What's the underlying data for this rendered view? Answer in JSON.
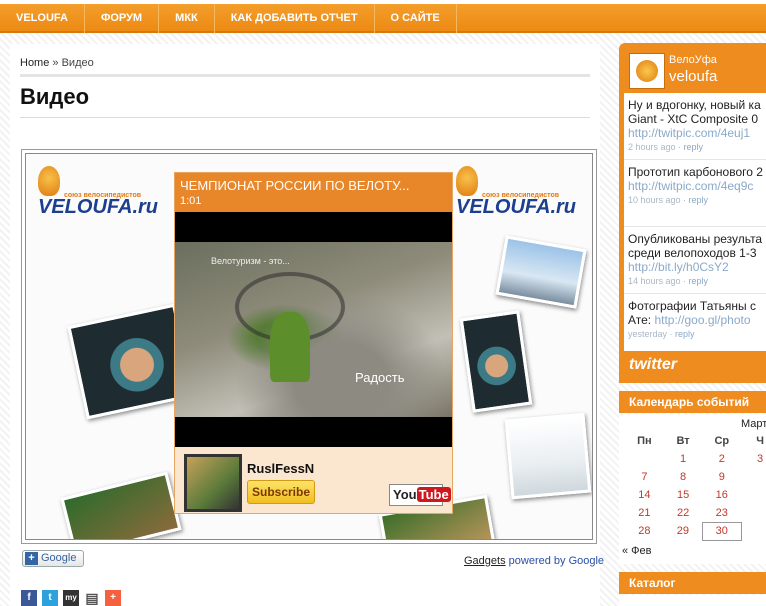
{
  "nav": {
    "items": [
      "VELOUFA",
      "ФОРУМ",
      "МКК",
      "КАК ДОБАВИТЬ ОТЧЕТ",
      "О САЙТЕ"
    ]
  },
  "breadcrumb": {
    "home": "Home",
    "separator": "»",
    "current": "Видео"
  },
  "page_title": "Видео",
  "gadget": {
    "logo_text": "VELOUFA.ru",
    "logo_sub": "союз велосипедистов",
    "player": {
      "title": "ЧЕМПИОНАТ РОССИИ ПО ВЕЛОТУ...",
      "duration": "1:01",
      "caption_1": "Велотуризм - это...",
      "caption_2": "Радость",
      "channel": "RuslFessN",
      "subscribe_label": "Subscribe",
      "youtube_you": "You",
      "youtube_tube": "Tube"
    }
  },
  "gplus_label": "Google",
  "gadgets_credit": {
    "gadgets": "Gadgets",
    "powered": "powered by Google"
  },
  "share_icons": [
    {
      "name": "facebook-icon",
      "glyph": "f",
      "color": "#3b5998"
    },
    {
      "name": "twitter-icon",
      "glyph": "t",
      "color": "#2ea1dc"
    },
    {
      "name": "myspace-icon",
      "glyph": "my",
      "color": "#333333"
    },
    {
      "name": "print-icon",
      "glyph": "▤",
      "color": "#555555"
    },
    {
      "name": "addthis-icon",
      "glyph": "+",
      "color": "#f5603e"
    }
  ],
  "twitter_widget": {
    "name": "ВелоУфа",
    "user": "veloufa",
    "footer": "twitter",
    "tweets": [
      {
        "text_1": "Ну и вдогонку, новый ка",
        "text_2": "Giant - XtC Composite 0",
        "link": "http://twitpic.com/4euj1",
        "time": "2 hours ago",
        "reply": "reply"
      },
      {
        "text_1": "Прототип карбонового 2",
        "text_2": "",
        "link": "http://twitpic.com/4eq9c",
        "time": "10 hours ago",
        "reply": "reply"
      },
      {
        "text_1": "Опубликованы результа",
        "text_2": "среди велопоходов 1-3",
        "link": "http://bit.ly/h0CsY2",
        "time": "14 hours ago",
        "reply": "reply"
      },
      {
        "text_1": "Фотографии Татьяны с",
        "text_2": "Ате:",
        "link": "http://goo.gl/photo",
        "time": "yesterday",
        "reply": "reply"
      }
    ]
  },
  "calendar": {
    "heading": "Календарь событий",
    "month": "Март",
    "weekdays": [
      "Пн",
      "Вт",
      "Ср",
      "Ч"
    ],
    "rows": [
      [
        "1",
        "2",
        "3"
      ],
      [
        "7",
        "8",
        "9"
      ],
      [
        "14",
        "15",
        "16"
      ],
      [
        "21",
        "22",
        "23"
      ],
      [
        "28",
        "29",
        "30"
      ]
    ],
    "prev": "« Фев"
  },
  "catalog_heading": "Каталог",
  "colors": {
    "accent": "#ee8c1f",
    "link": "#2a5fa8"
  }
}
